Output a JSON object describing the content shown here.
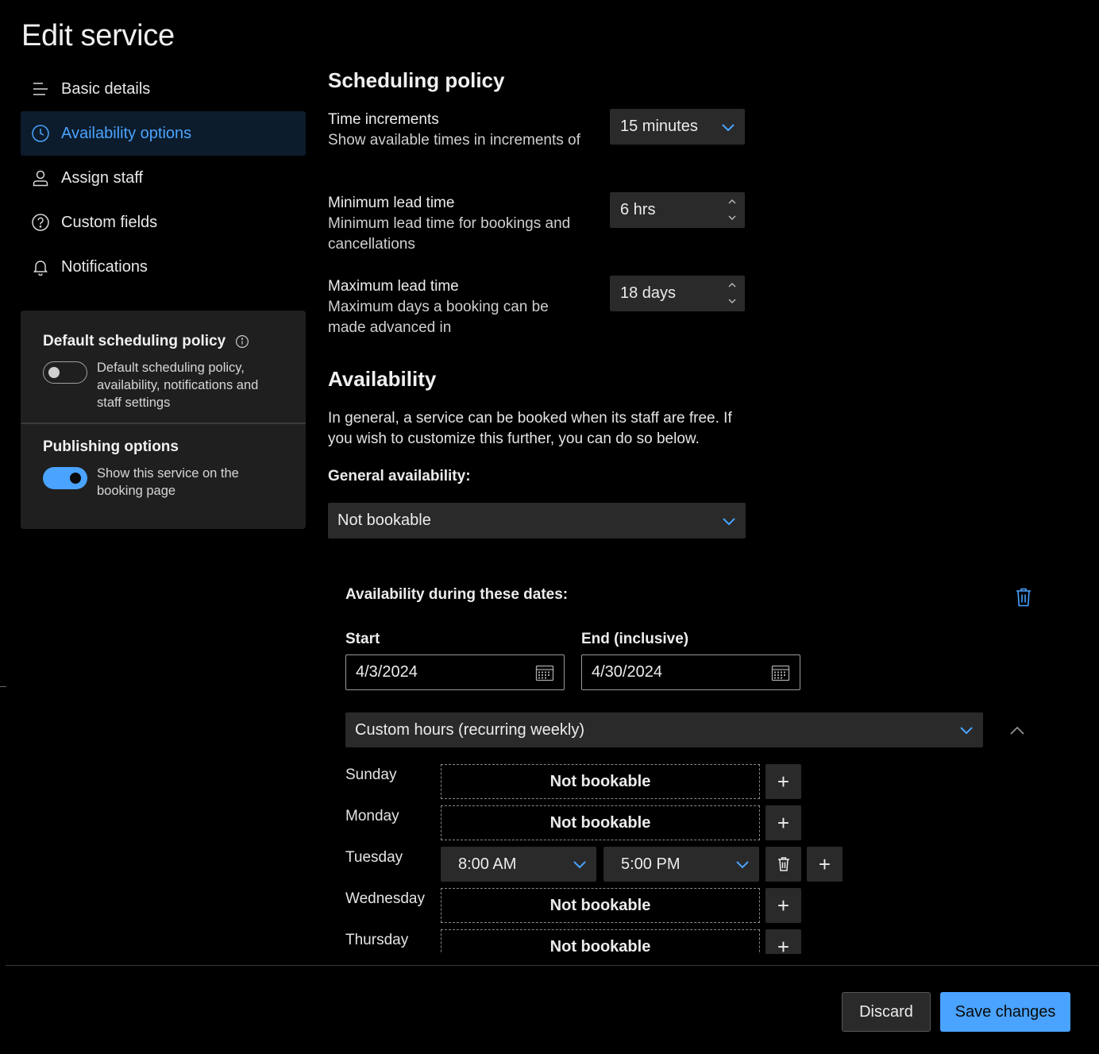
{
  "page": {
    "title": "Edit service"
  },
  "nav": {
    "items": [
      {
        "label": "Basic details",
        "icon": "text-lines-icon",
        "active": false
      },
      {
        "label": "Availability options",
        "icon": "clock-icon",
        "active": true
      },
      {
        "label": "Assign staff",
        "icon": "person-icon",
        "active": false
      },
      {
        "label": "Custom fields",
        "icon": "question-circle-icon",
        "active": false
      },
      {
        "label": "Notifications",
        "icon": "bell-icon",
        "active": false
      }
    ]
  },
  "side_card": {
    "default_policy": {
      "title": "Default scheduling policy",
      "toggle_on": false,
      "description": "Default scheduling policy, availability, notifications and staff settings"
    },
    "publishing": {
      "title": "Publishing options",
      "toggle_on": true,
      "description": "Show this service on the booking page"
    }
  },
  "scheduling": {
    "title": "Scheduling policy",
    "time_increments": {
      "label": "Time increments",
      "description": "Show available times in increments of",
      "value": "15 minutes"
    },
    "min_lead": {
      "label": "Minimum lead time",
      "description": "Minimum lead time for bookings and cancellations",
      "value": "6 hrs"
    },
    "max_lead": {
      "label": "Maximum lead time",
      "description": "Maximum days a booking can be made advanced in",
      "value": "18 days"
    }
  },
  "availability": {
    "title": "Availability",
    "description": "In general, a service can be booked when its staff are free. If you wish to customize this further, you can do so below.",
    "general_label": "General availability:",
    "general_value": "Not bookable",
    "dates_label": "Availability during these dates:",
    "start_label": "Start",
    "start_value": "4/3/2024",
    "end_label": "End (inclusive)",
    "end_value": "4/30/2024",
    "hours_mode": "Custom hours (recurring weekly)",
    "days": [
      {
        "day": "Sunday",
        "status": "Not bookable"
      },
      {
        "day": "Monday",
        "status": "Not bookable"
      },
      {
        "day": "Tuesday",
        "start": "8:00 AM",
        "end": "5:00 PM"
      },
      {
        "day": "Wednesday",
        "status": "Not bookable"
      },
      {
        "day": "Thursday",
        "status": "Not bookable"
      }
    ]
  },
  "footer": {
    "discard_label": "Discard",
    "save_label": "Save changes"
  },
  "colors": {
    "accent": "#4aa3ff",
    "background": "#000000",
    "panel": "#1f1f1f",
    "control": "#2a2a2a"
  }
}
